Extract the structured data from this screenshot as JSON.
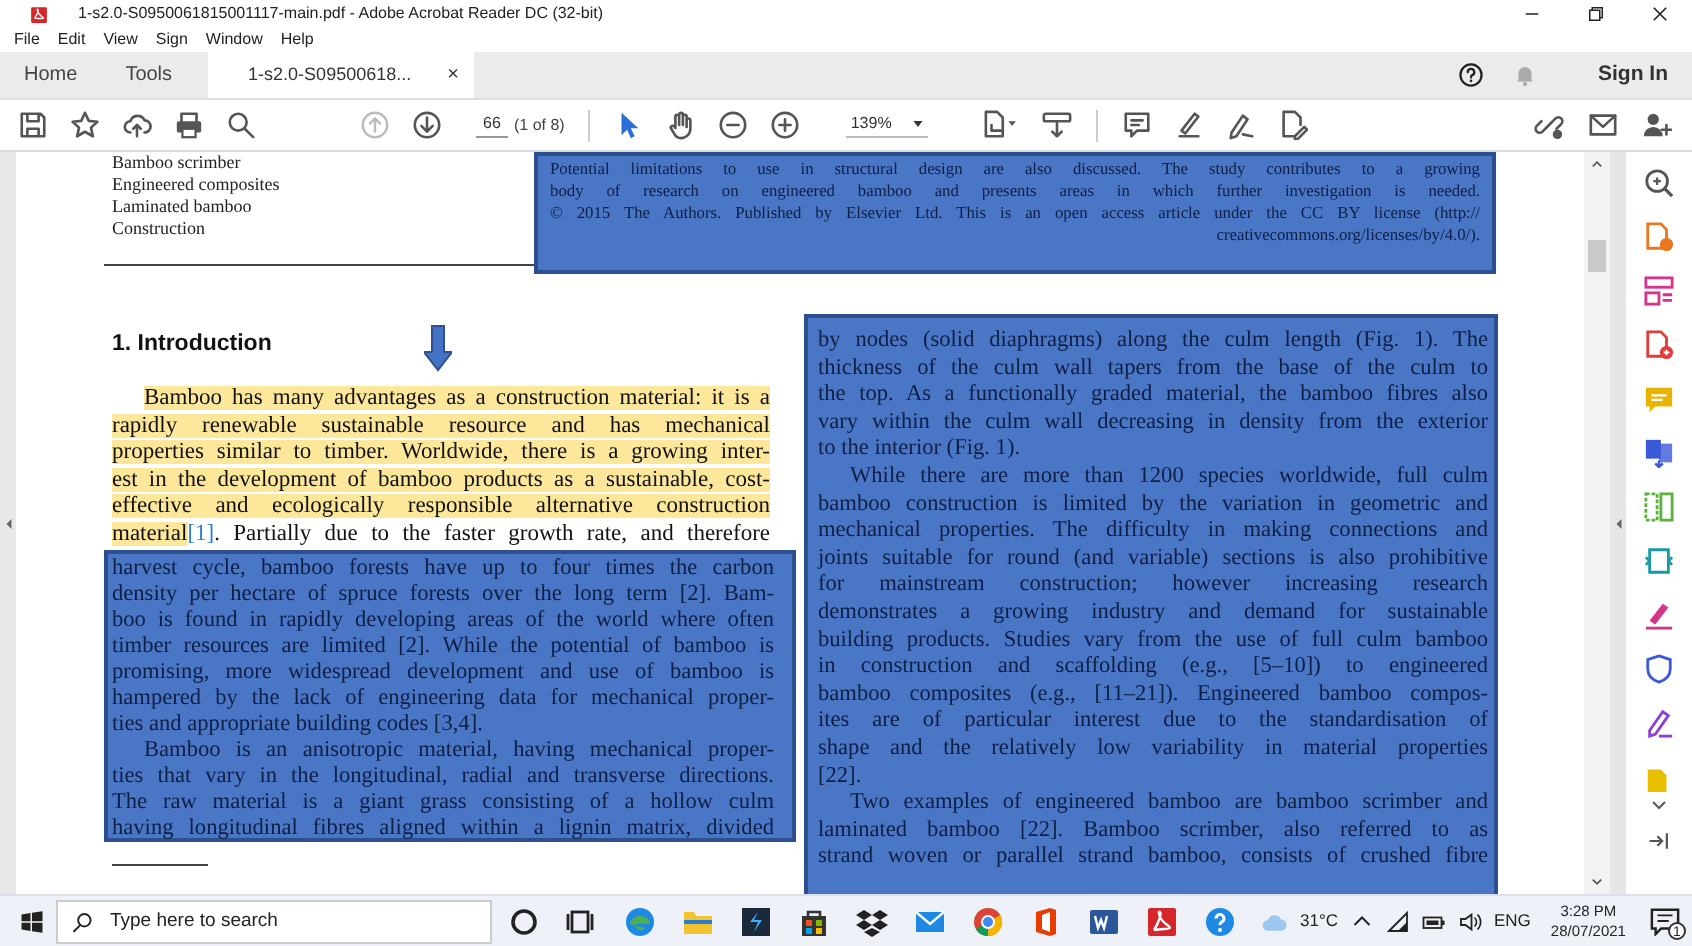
{
  "window": {
    "title": "1-s2.0-S0950061815001117-main.pdf - Adobe Acrobat Reader DC (32-bit)"
  },
  "menu": [
    "File",
    "Edit",
    "View",
    "Sign",
    "Window",
    "Help"
  ],
  "tabs": [
    {
      "label": "Home",
      "selected": false
    },
    {
      "label": "Tools",
      "selected": false
    },
    {
      "label": "1-s2.0-S09500618...",
      "selected": true,
      "close": "×"
    }
  ],
  "sign_in": "Sign In",
  "toolbar": {
    "page_number": "66",
    "page_count": "(1 of 8)",
    "zoom": "139%"
  },
  "document": {
    "keywords": [
      "Bamboo scrimber",
      "Engineered composites",
      "Laminated bamboo",
      "Construction"
    ],
    "abstract_overlay": {
      "lines": [
        "Potential limitations to use in structural design are also discussed. The study contributes to a growing",
        "body of research on engineered bamboo and presents areas in which further investigation is needed.",
        "© 2015 The Authors. Published by Elsevier Ltd. This is an open access article under the CC BY license (http://"
      ],
      "link": "creativecommons.org/licenses/by/4.0/)."
    },
    "heading": "1. Introduction",
    "intro": {
      "highlighted_lines": [
        "Bamboo has many advantages as a construction material: it is a",
        "rapidly renewable sustainable resource and has mechanical",
        "properties similar to timber. Worldwide, there is a growing inter-",
        "est in the development of bamboo products as a sustainable, cost-",
        "effective and ecologically responsible alternative construction",
        "material"
      ],
      "citation": "[1]",
      "continuation": ". Partially due to the faster growth rate, and therefore"
    },
    "left_overlay": {
      "paragraphs": [
        {
          "lines": [
            "harvest cycle, bamboo forests have up to four times the carbon",
            "density per hectare of spruce forests over the long term [2]. Bam-",
            "boo is found in rapidly developing areas of the world where often",
            "timber resources are limited [2]. While the potential of bamboo is",
            "promising, more widespread development and use of bamboo is",
            "hampered by the lack of engineering data for mechanical proper-",
            "ties and appropriate building codes [3,4]."
          ]
        },
        {
          "lines": [
            "Bamboo is an anisotropic material, having mechanical proper-",
            "ties that vary in the longitudinal, radial and transverse directions.",
            "The raw material is a giant grass consisting of a hollow culm",
            "having longitudinal fibres aligned within a lignin matrix, divided"
          ]
        }
      ]
    },
    "right_overlay": {
      "paragraphs": [
        {
          "lines": [
            "by nodes (solid diaphragms) along the culm length (Fig. 1). The",
            "thickness of the culm wall tapers from the base of the culm to",
            "the top. As a functionally graded material, the bamboo fibres also",
            "vary within the culm wall decreasing in density from the exterior",
            "to the interior (Fig. 1)."
          ]
        },
        {
          "lines": [
            "While there are more than 1200 species worldwide, full culm",
            "bamboo construction is limited by the variation in geometric and",
            "mechanical properties. The difficulty in making connections and",
            "joints suitable for round (and variable) sections is also prohibitive",
            "for mainstream construction; however increasing research",
            "demonstrates a growing industry and demand for sustainable",
            "building products. Studies vary from the use of full culm bamboo",
            "in construction and scaffolding (e.g., [5–10]) to engineered",
            "bamboo composites (e.g., [11–21]). Engineered bamboo compos-",
            "ites are of particular interest due to the standardisation of",
            "shape and the relatively low variability in material properties",
            "[22]."
          ]
        },
        {
          "lines": [
            "Two examples of engineered bamboo are bamboo scrimber and",
            "laminated bamboo [22]. Bamboo scrimber, also referred to as",
            "strand woven or parallel strand bamboo, consists of crushed fibre"
          ]
        }
      ]
    }
  },
  "taskbar": {
    "search_placeholder": "Type here to search",
    "temperature": "31°C",
    "language": "ENG",
    "time": "3:28 PM",
    "date": "28/07/2021",
    "notifications": "1"
  }
}
